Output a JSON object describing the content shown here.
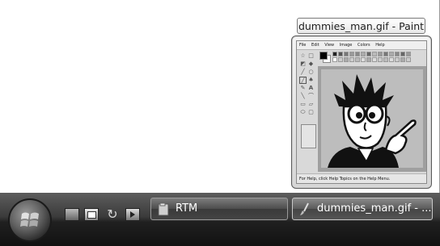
{
  "thumbnail": {
    "title": "dummies_man.gif - Paint",
    "paint": {
      "menu": [
        "File",
        "Edit",
        "View",
        "Image",
        "Colors",
        "Help"
      ],
      "status": "For Help, click Help Topics on the Help Menu."
    }
  },
  "taskbar": {
    "quick_launch": [
      "show-desktop-icon",
      "window-switcher-icon",
      "refresh-icon",
      "media-player-icon"
    ],
    "buttons": [
      {
        "label": "RTM",
        "icon": "folder-icon",
        "active": false
      },
      {
        "label": "dummies_man.gif - ...",
        "icon": "paint-brush-icon",
        "active": true
      }
    ]
  },
  "colors": {
    "taskbar_top": "#5d5d5d",
    "taskbar_bottom": "#111111",
    "canvas_bg": "#bdbdbd"
  }
}
